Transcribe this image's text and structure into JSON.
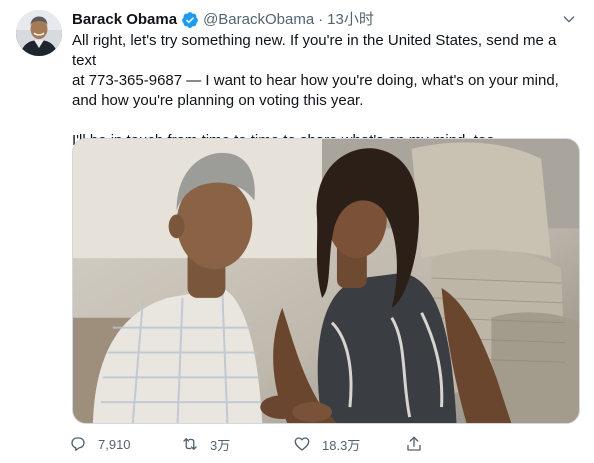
{
  "tweet": {
    "author": {
      "name": "Barack Obama",
      "handle": "@BarackObama",
      "verified": true,
      "avatar_icon": "avatar-photo"
    },
    "separator": "·",
    "time": "13小时",
    "text_lines": [
      "All right, let's try something new. If you're in the United States, send me a text",
      "at 773-365-9687 — I want to hear how you're doing, what's on your mind,",
      "and how you're planning on voting this year.",
      "I'll be in touch from time to time to share what's on my mind, too."
    ],
    "media": {
      "kind": "photo"
    },
    "actions": {
      "reply_count": "7,910",
      "retweet_count": "3万",
      "like_count": "18.3万",
      "share_count": ""
    }
  },
  "colors": {
    "text_primary": "#0f1419",
    "text_secondary": "#536471",
    "verified_blue": "#1d9bf0",
    "border": "#cfd9de"
  },
  "icons": {
    "verified": "verified-badge-icon",
    "caret": "chevron-down-icon",
    "reply": "reply-icon",
    "retweet": "retweet-icon",
    "like": "heart-icon",
    "share": "share-icon"
  }
}
